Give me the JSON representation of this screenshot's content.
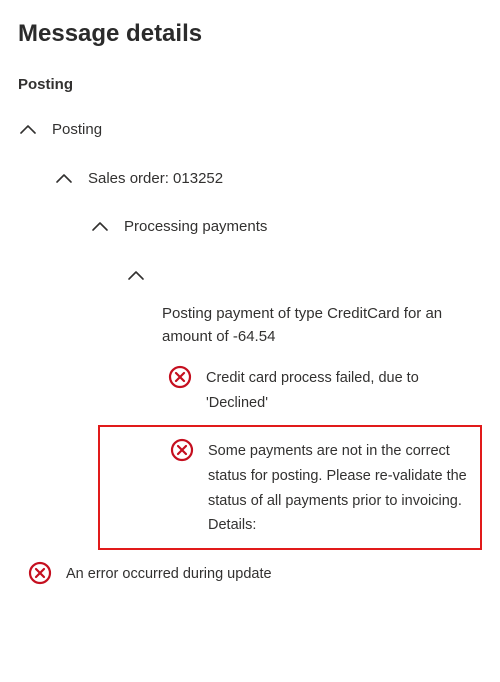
{
  "title": "Message details",
  "sectionLabel": "Posting",
  "tree": {
    "l0": {
      "label": "Posting"
    },
    "l1": {
      "label": "Sales order: 013252"
    },
    "l2": {
      "label": "Processing payments"
    },
    "l3_body": "Posting payment of type CreditCard for an amount of -64.54"
  },
  "messages": {
    "m1": "Credit card process failed, due to 'Declined'",
    "m2": "Some payments are not in the correct status for posting. Please re-validate the status of all payments prior to invoicing. Details:",
    "m3": "An error occurred during update"
  },
  "colors": {
    "error": "#c50f1f",
    "highlight": "#e11a1a",
    "text": "#323130"
  }
}
